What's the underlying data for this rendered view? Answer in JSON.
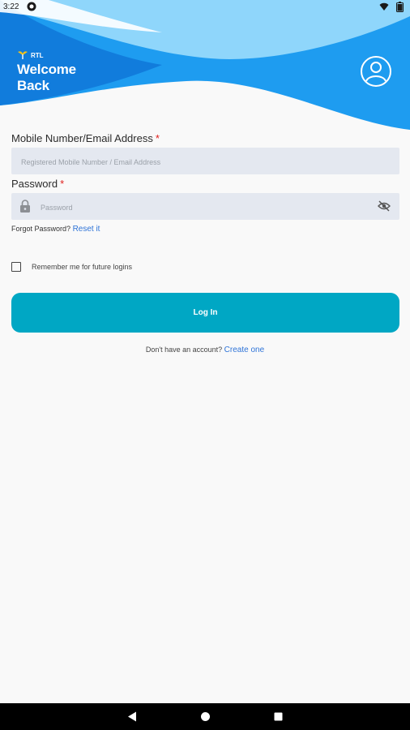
{
  "status_bar": {
    "time": "3:22"
  },
  "header": {
    "brand": "RTL",
    "title": "Welcome Back"
  },
  "form": {
    "login_field": {
      "label": "Mobile Number/Email Address",
      "required_mark": "*",
      "placeholder": "Registered Mobile Number / Email Address",
      "value": ""
    },
    "password_field": {
      "label": "Password",
      "required_mark": "*",
      "placeholder": "Password",
      "value": ""
    },
    "forgot": {
      "text": "Forgot Password?",
      "link": "Reset it"
    },
    "remember": {
      "label": "Remember me for future logins",
      "checked": false
    },
    "login_button": "Log In",
    "signup": {
      "text": "Don't have an account?",
      "link": "Create one"
    }
  },
  "colors": {
    "header_blue": "#1e9cf0",
    "header_dark": "#0d72d6",
    "header_light": "#8fd6fb",
    "button": "#00a7c4",
    "link": "#2f74d8",
    "required": "#e0201d",
    "input_bg": "#e4e8f0"
  },
  "icons": [
    "app-notification-icon",
    "wifi-icon",
    "battery-icon",
    "profile-icon",
    "lock-icon",
    "eye-off-icon",
    "back-icon",
    "home-icon",
    "recents-icon"
  ]
}
